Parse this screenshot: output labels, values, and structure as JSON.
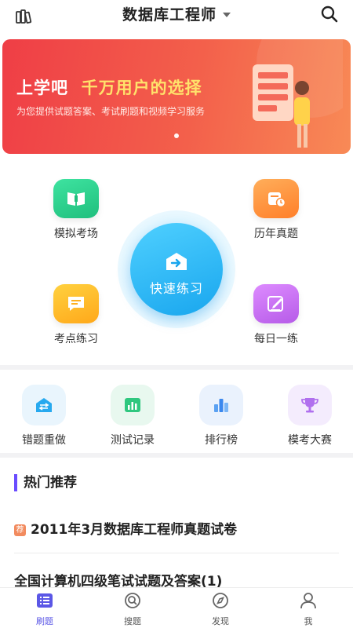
{
  "header": {
    "title": "数据库工程师",
    "left_icon": "books-icon",
    "search_icon": "search-icon"
  },
  "banner": {
    "title_part1": "上学吧",
    "title_highlight": "千万用户的选择",
    "subtitle": "为您提供试题答案、考试刷题和视频学习服务",
    "gradient_from": "#ef3e46",
    "gradient_to": "#f88a56"
  },
  "features": {
    "mock_exam": {
      "label": "模拟考场",
      "icon": "book-icon",
      "color": "#2fd08b"
    },
    "past_papers": {
      "label": "历年真题",
      "icon": "calendar-clock-icon",
      "color": "#ff8f3a"
    },
    "quick_practice": {
      "label": "快速练习",
      "icon": "envelope-arrow-icon",
      "color": "#19a6ee"
    },
    "topic_practice": {
      "label": "考点练习",
      "icon": "chat-lines-icon",
      "color": "#ffbb1f"
    },
    "daily_practice": {
      "label": "每日一练",
      "icon": "edit-icon",
      "color": "#c86af0"
    }
  },
  "tools": [
    {
      "label": "错题重做",
      "icon": "swap-icon"
    },
    {
      "label": "测试记录",
      "icon": "bar-chart-icon"
    },
    {
      "label": "排行榜",
      "icon": "ranking-bars-icon"
    },
    {
      "label": "模考大赛",
      "icon": "trophy-icon"
    }
  ],
  "hot": {
    "title": "热门推荐",
    "badge": "荐",
    "items": [
      "2011年3月数据库工程师真题试卷",
      "全国计算机四级笔试试题及答案(1)"
    ]
  },
  "tabbar": [
    {
      "label": "刷题",
      "icon": "list-icon",
      "active": true
    },
    {
      "label": "搜题",
      "icon": "search-circle-icon",
      "active": false
    },
    {
      "label": "发现",
      "icon": "compass-icon",
      "active": false
    },
    {
      "label": "我",
      "icon": "user-icon",
      "active": false
    }
  ],
  "accent_color": "#5b57e6"
}
